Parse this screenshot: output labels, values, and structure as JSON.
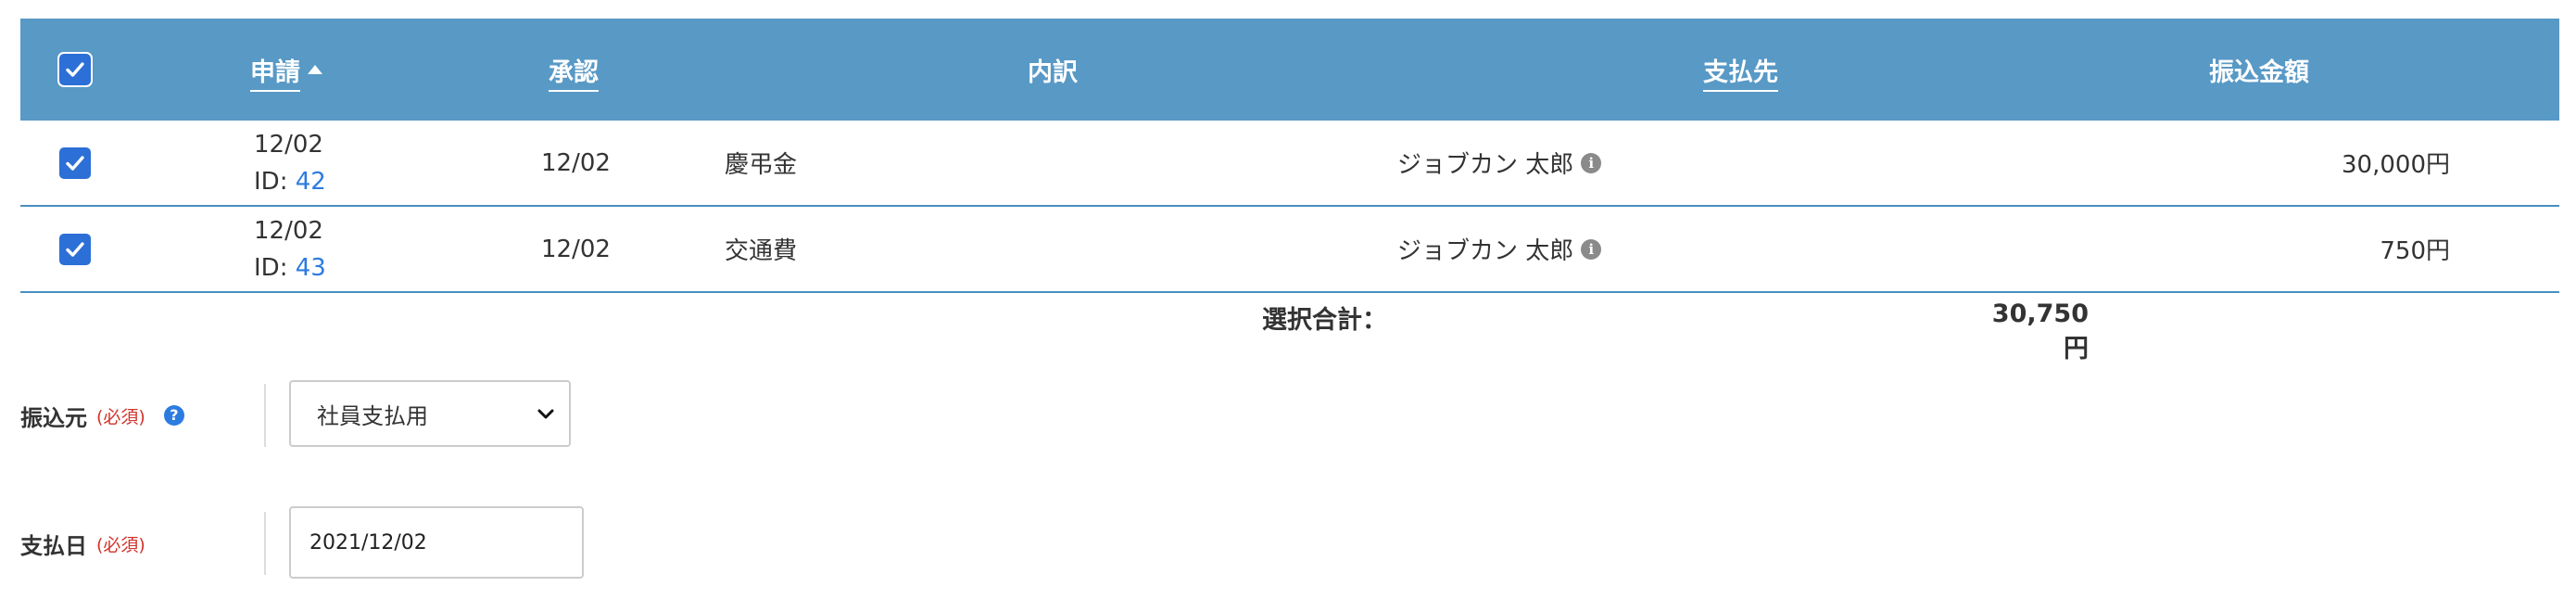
{
  "table": {
    "headers": {
      "apply": "申請",
      "approve": "承認",
      "detail": "内訳",
      "payee": "支払先",
      "amount": "振込金額"
    },
    "rows": [
      {
        "selected": true,
        "apply_date": "12/02",
        "id_label": "ID:",
        "id": "42",
        "approve_date": "12/02",
        "detail": "慶弔金",
        "payee": "ジョブカン 太郎",
        "amount": "30,000円"
      },
      {
        "selected": true,
        "apply_date": "12/02",
        "id_label": "ID:",
        "id": "43",
        "approve_date": "12/02",
        "detail": "交通費",
        "payee": "ジョブカン 太郎",
        "amount": "750円"
      }
    ],
    "total_label": "選択合計：",
    "total_value": "30,750円"
  },
  "form": {
    "source": {
      "label": "振込元",
      "required": "(必須)",
      "value": "社員支払用"
    },
    "payment_date": {
      "label": "支払日",
      "required": "(必須)",
      "value": "2021/12/02"
    }
  },
  "colors": {
    "header_bg": "#5899c6",
    "checkbox": "#2c6fd6",
    "link": "#2c7be0",
    "required": "#d0342c"
  }
}
